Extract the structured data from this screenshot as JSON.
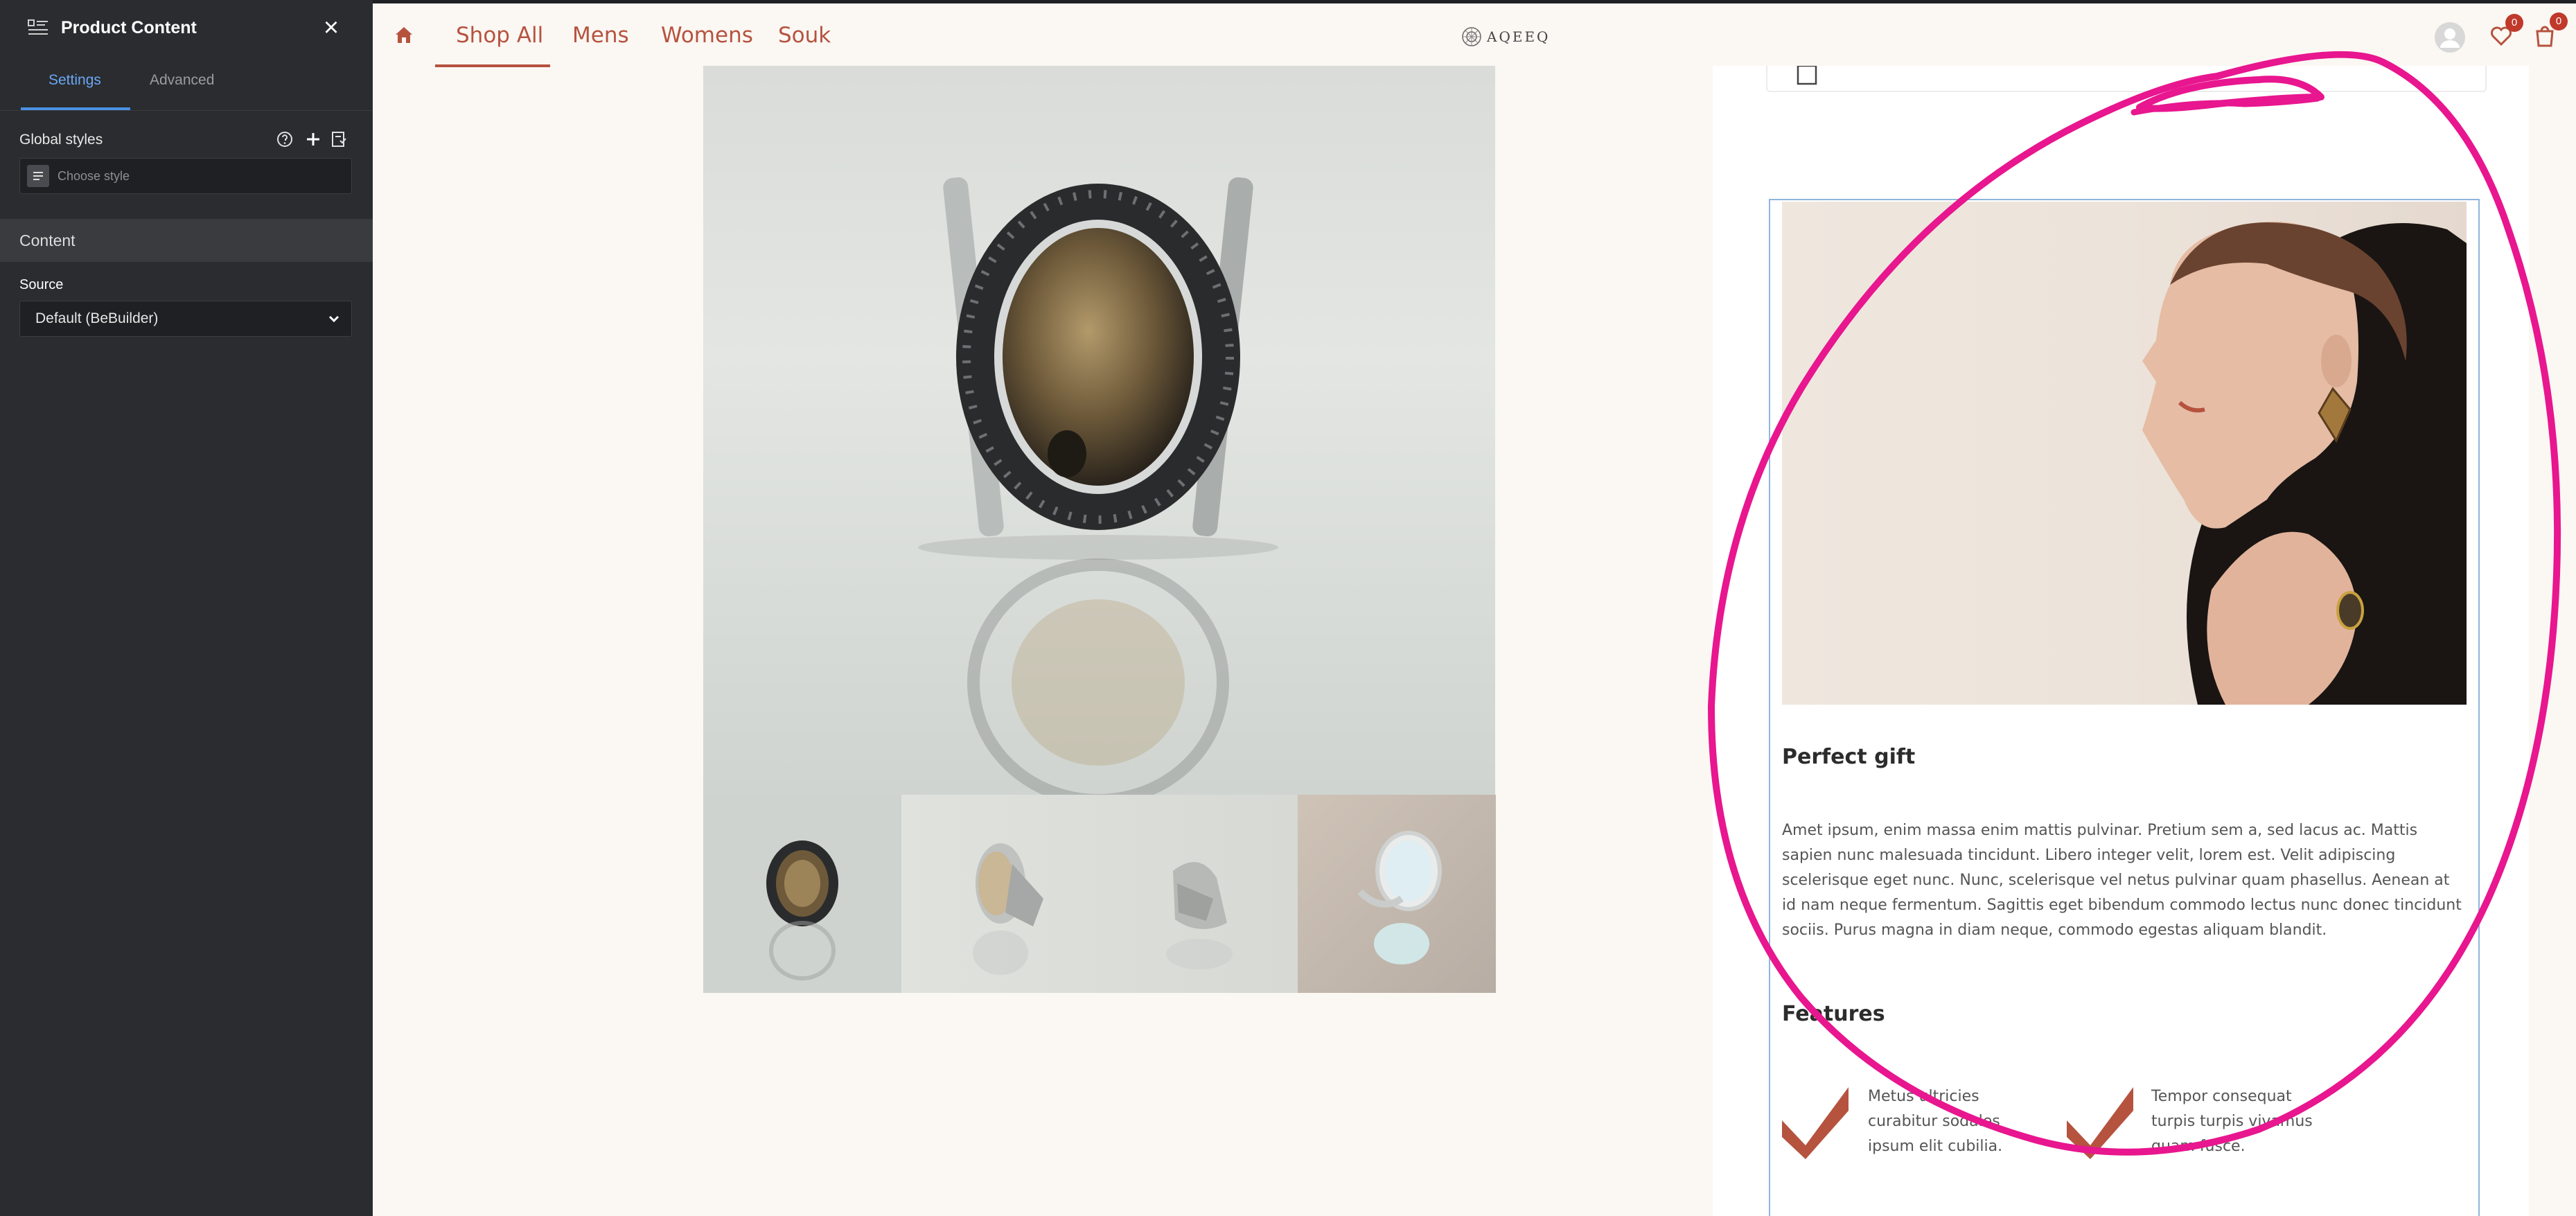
{
  "panel": {
    "title": "Product Content",
    "tabs": [
      {
        "label": "Settings",
        "active": true
      },
      {
        "label": "Advanced",
        "active": false
      }
    ],
    "global_styles": {
      "label": "Global styles",
      "placeholder": "Choose style",
      "icons": [
        "help-icon",
        "plus-icon",
        "save-style-icon"
      ]
    },
    "content_section": "Content",
    "source": {
      "label": "Source",
      "value": "Default (BeBuilder)"
    },
    "accent_color": "#4a90e2"
  },
  "site": {
    "nav": {
      "items": [
        "Shop All",
        "Mens",
        "Womens",
        "Souk"
      ],
      "active": "Shop All",
      "color": "#b5533f"
    },
    "logo_text": "AQEEQ",
    "wishlist_count": "0",
    "cart_count": "0"
  },
  "product": {
    "thumbnails": [
      "thumbnail-agate-ring",
      "thumbnail-ring-side",
      "thumbnail-ring-angle",
      "thumbnail-opal-ring"
    ]
  },
  "content": {
    "gift_heading": "Perfect gift",
    "gift_text": "Amet ipsum, enim massa enim mattis pulvinar. Pretium sem a, sed lacus ac. Mattis sapien nunc malesuada tincidunt. Libero integer velit, lorem est. Velit adipiscing scelerisque eget nunc. Nunc, scelerisque vel netus pulvinar quam phasellus. Aenean at id nam neque fermentum. Sagittis eget bibendum commodo lectus nunc donec tincidunt sociis. Purus magna in diam neque, commodo egestas aliquam blandit.",
    "features_heading": "Features",
    "features": [
      {
        "text": "Metus ultricies curabitur sodales ipsum elit cubilia."
      },
      {
        "text": "Tempor consequat turpis turpis vivamus quam fusce."
      }
    ],
    "annotation_color": "#e8168f"
  }
}
